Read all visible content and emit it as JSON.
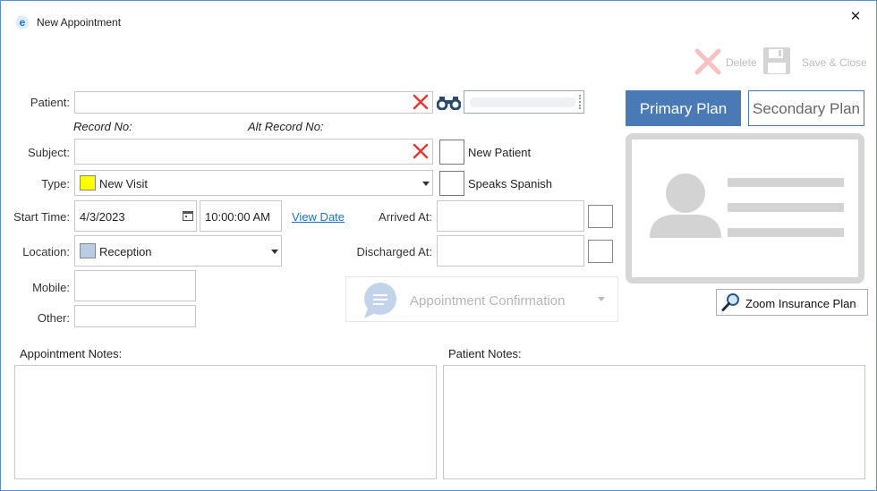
{
  "window": {
    "title": "New Appointment",
    "close": "✕"
  },
  "toolbar": {
    "delete_label": "Delete",
    "save_close_label": "Save & Close"
  },
  "patient": {
    "label": "Patient:",
    "value": "",
    "record_no_label": "Record No:",
    "alt_record_no_label": "Alt Record No:"
  },
  "subject": {
    "label": "Subject:",
    "value": ""
  },
  "type": {
    "label": "Type:",
    "value": "New Visit",
    "color": "#ffff00"
  },
  "start_time": {
    "label": "Start Time:",
    "date": "4/3/2023",
    "time": "10:00:00 AM",
    "view_date": "View Date"
  },
  "location": {
    "label": "Location:",
    "value": "Reception",
    "color": "#b8cde4"
  },
  "mobile": {
    "label": "Mobile:",
    "value": ""
  },
  "other": {
    "label": "Other:",
    "value": ""
  },
  "checks": {
    "new_patient": "New Patient",
    "speaks_spanish": "Speaks Spanish"
  },
  "arrived": {
    "label": "Arrived At:",
    "value": ""
  },
  "discharged": {
    "label": "Discharged At:",
    "value": ""
  },
  "confirmation": {
    "label": "Appointment Confirmation"
  },
  "plans": {
    "primary": "Primary Plan",
    "secondary": "Secondary Plan",
    "zoom": "Zoom Insurance Plan"
  },
  "notes": {
    "appointment_label": "Appointment Notes:",
    "patient_label": "Patient Notes:",
    "appointment_value": "",
    "patient_value": ""
  },
  "colors": {
    "accent": "#4a7ab5",
    "red_x": "#e53935",
    "link": "#1a73c8"
  }
}
